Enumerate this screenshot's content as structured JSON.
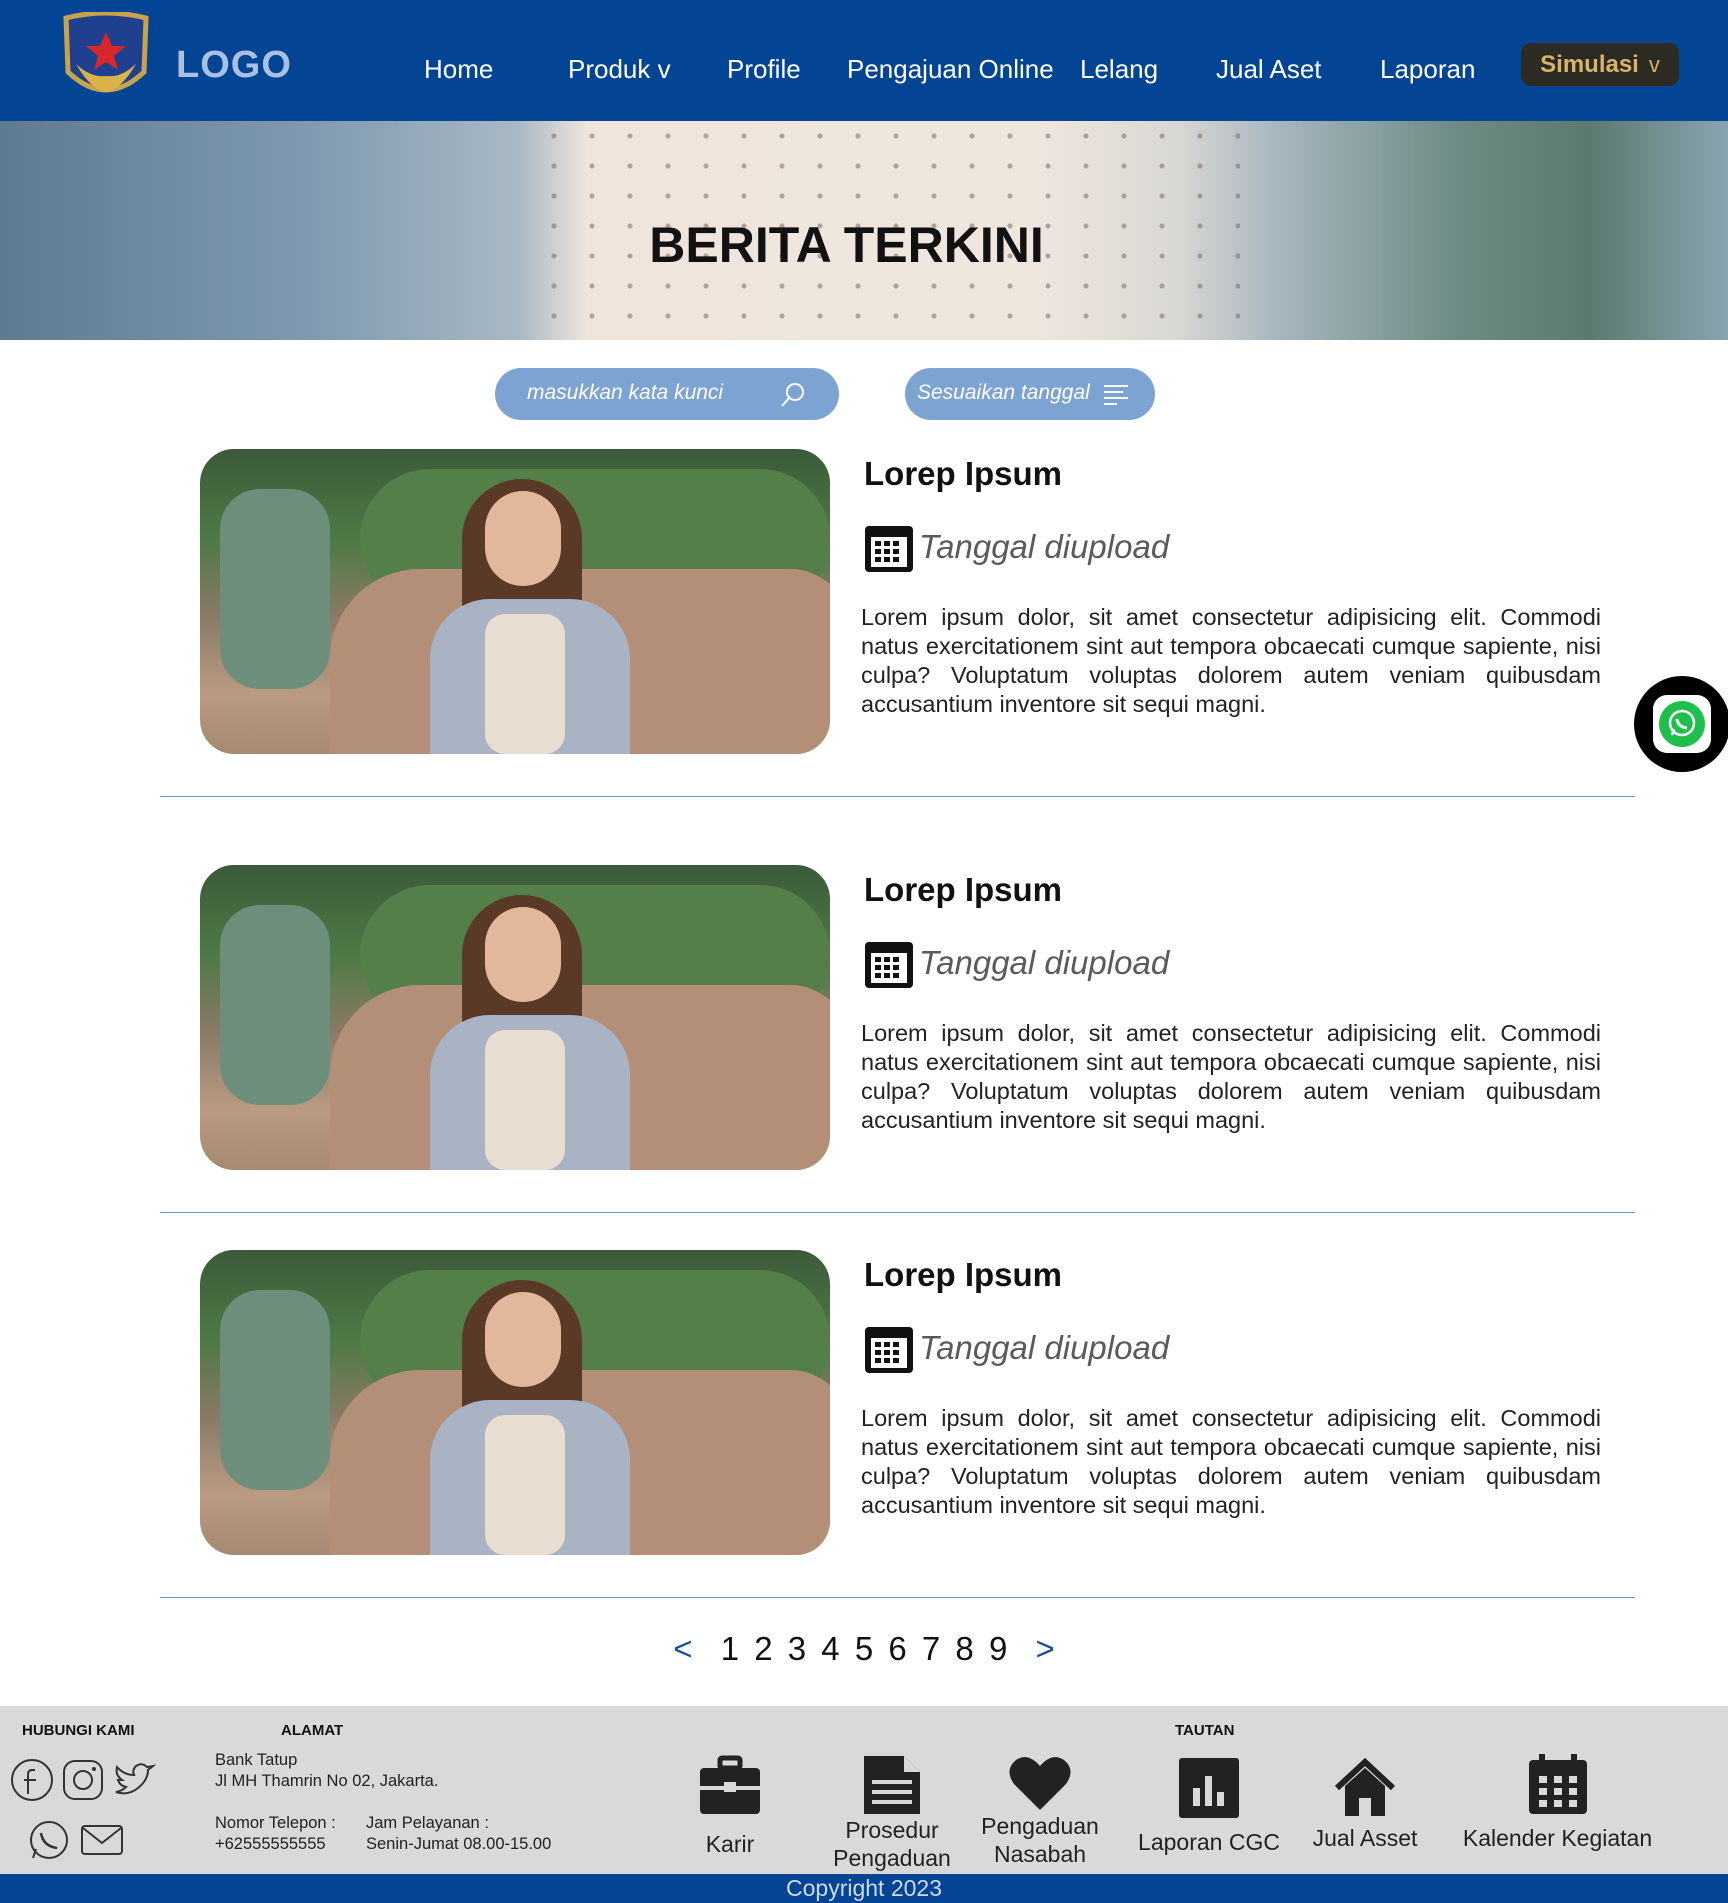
{
  "header": {
    "logo_text": "LOGO",
    "nav": [
      {
        "label": "Home"
      },
      {
        "label": "Produk v"
      },
      {
        "label": "Profile"
      },
      {
        "label": "Pengajuan Online"
      },
      {
        "label": "Lelang"
      },
      {
        "label": "Jual Aset"
      },
      {
        "label": "Laporan"
      }
    ],
    "simulasi": {
      "label": "Simulasi",
      "chevron": "v"
    },
    "colors": {
      "bar": "#034594",
      "simulasi_bg": "#2b2a23",
      "simulasi_text": "#d9b36b"
    }
  },
  "hero": {
    "title": "BERITA TERKINI"
  },
  "filters": {
    "search_placeholder": "masukkan kata kunci",
    "search_icon": "search-icon",
    "date_label": "Sesuaikan tanggal",
    "date_icon": "filter-lines-icon",
    "pill_color": "#7da3d3"
  },
  "news": [
    {
      "title": "Lorep Ipsum",
      "date": "Tanggal diupload",
      "body": "Lorem ipsum dolor, sit amet consectetur adipisicing elit. Commodi natus exercitationem sint aut tempora obcaecati cumque sapiente, nisi culpa? Voluptatum voluptas dolorem autem veniam quibusdam accusantium inventore sit sequi magni."
    },
    {
      "title": "Lorep Ipsum",
      "date": "Tanggal diupload",
      "body": "Lorem ipsum dolor, sit amet consectetur adipisicing elit. Commodi natus exercitationem sint aut tempora obcaecati cumque sapiente, nisi culpa? Voluptatum voluptas dolorem autem veniam quibusdam accusantium inventore sit sequi magni."
    },
    {
      "title": "Lorep Ipsum",
      "date": "Tanggal diupload",
      "body": "Lorem ipsum dolor, sit amet consectetur adipisicing elit. Commodi natus exercitationem sint aut tempora obcaecati cumque sapiente, nisi culpa? Voluptatum voluptas dolorem autem veniam quibusdam accusantium inventore sit sequi magni."
    }
  ],
  "pagination": {
    "prev": "<",
    "next": ">",
    "pages": [
      "1",
      "2",
      "3",
      "4",
      "5",
      "6",
      "7",
      "8",
      "9"
    ]
  },
  "footer": {
    "contact": {
      "heading": "HUBUNGI KAMI",
      "icons": [
        "facebook-icon",
        "instagram-icon",
        "twitter-icon",
        "whatsapp-icon",
        "mail-icon"
      ]
    },
    "address": {
      "heading": "ALAMAT",
      "line1": "Bank Tatup",
      "line2": "Jl MH Thamrin No 02, Jakarta.",
      "phone_label": "Nomor Telepon :",
      "phone_value": "+62555555555",
      "hours_label": "Jam Pelayanan :",
      "hours_value": "Senin-Jumat 08.00-15.00"
    },
    "links_heading": "TAUTAN",
    "links": [
      {
        "label_1": "Karir",
        "label_2": "",
        "icon": "briefcase-icon"
      },
      {
        "label_1": "Prosedur",
        "label_2": "Pengaduan",
        "icon": "document-icon"
      },
      {
        "label_1": "Pengaduan",
        "label_2": "Nasabah",
        "icon": "heart-icon"
      },
      {
        "label_1": "Laporan CGC",
        "label_2": "",
        "icon": "bar-chart-icon"
      },
      {
        "label_1": "Jual Asset",
        "label_2": "",
        "icon": "home-icon"
      },
      {
        "label_1": "Kalender Kegiatan",
        "label_2": "",
        "icon": "calendar-icon"
      }
    ]
  },
  "copyright": "Copyright 2023"
}
